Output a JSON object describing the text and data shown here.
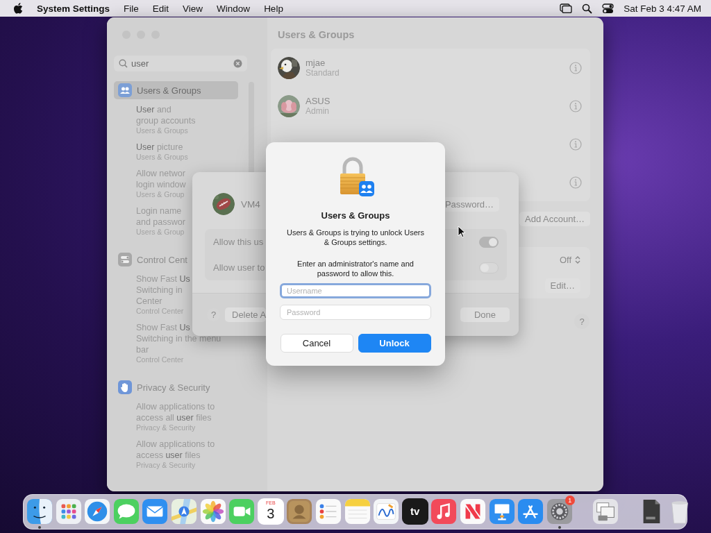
{
  "menu_bar": {
    "app_name": "System Settings",
    "menus": [
      "File",
      "Edit",
      "View",
      "Window",
      "Help"
    ],
    "clock": "Sat Feb 3  4:47 AM"
  },
  "window": {
    "title": "Users & Groups"
  },
  "sidebar": {
    "search": {
      "value": "user"
    },
    "groups": [
      {
        "kind": "users",
        "title": "Users & Groups",
        "selected": true,
        "results": [
          {
            "lines": [
              "**User** and",
              "group accounts"
            ],
            "source": "Users & Groups"
          },
          {
            "lines": [
              "**User** picture"
            ],
            "source": "Users & Groups"
          },
          {
            "lines": [
              "Allow networ",
              "login window"
            ],
            "source": "Users & Group"
          },
          {
            "lines": [
              "Login name",
              "and passwor"
            ],
            "source": "Users & Group"
          }
        ]
      },
      {
        "kind": "control",
        "title": "Control Cent",
        "selected": false,
        "results": [
          {
            "lines": [
              "Show Fast **Us**",
              "Switching in",
              "Center"
            ],
            "source": "Control Center"
          },
          {
            "lines": [
              "Show Fast **Us**",
              "Switching in the menu",
              "bar"
            ],
            "source": "Control Center"
          }
        ]
      },
      {
        "kind": "privacy",
        "title": "Privacy & Security",
        "selected": false,
        "results": [
          {
            "lines": [
              "Allow applications to",
              "access all **user** files"
            ],
            "source": "Privacy & Security"
          },
          {
            "lines": [
              "Allow applications to",
              "access **user** files"
            ],
            "source": "Privacy & Security"
          }
        ]
      }
    ]
  },
  "users": [
    {
      "kind": "account",
      "name": "mjae",
      "role": "Standard"
    },
    {
      "kind": "account",
      "name": "ASUS",
      "role": "Admin"
    },
    {
      "kind": "covered"
    },
    {
      "kind": "covered"
    }
  ],
  "add_account": "Add Account…",
  "settings": [
    {
      "kind": "popup",
      "value": "Off"
    },
    {
      "kind": "button",
      "value": "Edit…"
    }
  ],
  "help": "?",
  "sheet": {
    "user": "VM4",
    "password_button": "Password…",
    "options": [
      {
        "label": "Allow this us",
        "on": true
      },
      {
        "label": "Allow user to",
        "on": false
      }
    ],
    "help": "?",
    "delete_button": "Delete A",
    "done_button": "Done"
  },
  "dialog": {
    "title": "Users & Groups",
    "message": "Users & Groups is trying to unlock Users & Groups settings.",
    "info": "Enter an administrator's name and password to allow this.",
    "username": {
      "placeholder": "Username",
      "focused": true
    },
    "password": {
      "placeholder": "Password",
      "focused": false
    },
    "cancel": "Cancel",
    "unlock": "Unlock"
  },
  "dock": {
    "sections": [
      {
        "items": [
          {
            "kind": "finder",
            "running": true
          },
          {
            "kind": "launchpad",
            "running": false
          },
          {
            "kind": "safari",
            "running": false
          },
          {
            "kind": "messages",
            "running": false
          },
          {
            "kind": "mail",
            "running": false
          },
          {
            "kind": "maps",
            "running": false
          },
          {
            "kind": "photos",
            "running": false
          },
          {
            "kind": "facetime",
            "running": false
          },
          {
            "kind": "calendar",
            "running": false,
            "month": "FEB",
            "day": "3"
          },
          {
            "kind": "contacts",
            "running": false
          },
          {
            "kind": "reminders",
            "running": false
          },
          {
            "kind": "notes",
            "running": false
          },
          {
            "kind": "freeform",
            "running": false
          },
          {
            "kind": "tv",
            "running": false,
            "label": "tv"
          },
          {
            "kind": "music",
            "running": false
          },
          {
            "kind": "news",
            "running": false
          },
          {
            "kind": "keynote",
            "running": false
          },
          {
            "kind": "appstore",
            "running": false
          },
          {
            "kind": "settings",
            "running": true,
            "badge": "1"
          }
        ]
      },
      {
        "items": [
          {
            "kind": "diskutility",
            "running": false
          }
        ]
      },
      {
        "items": [
          {
            "kind": "document",
            "running": false
          },
          {
            "kind": "trash",
            "running": false
          }
        ]
      }
    ]
  }
}
